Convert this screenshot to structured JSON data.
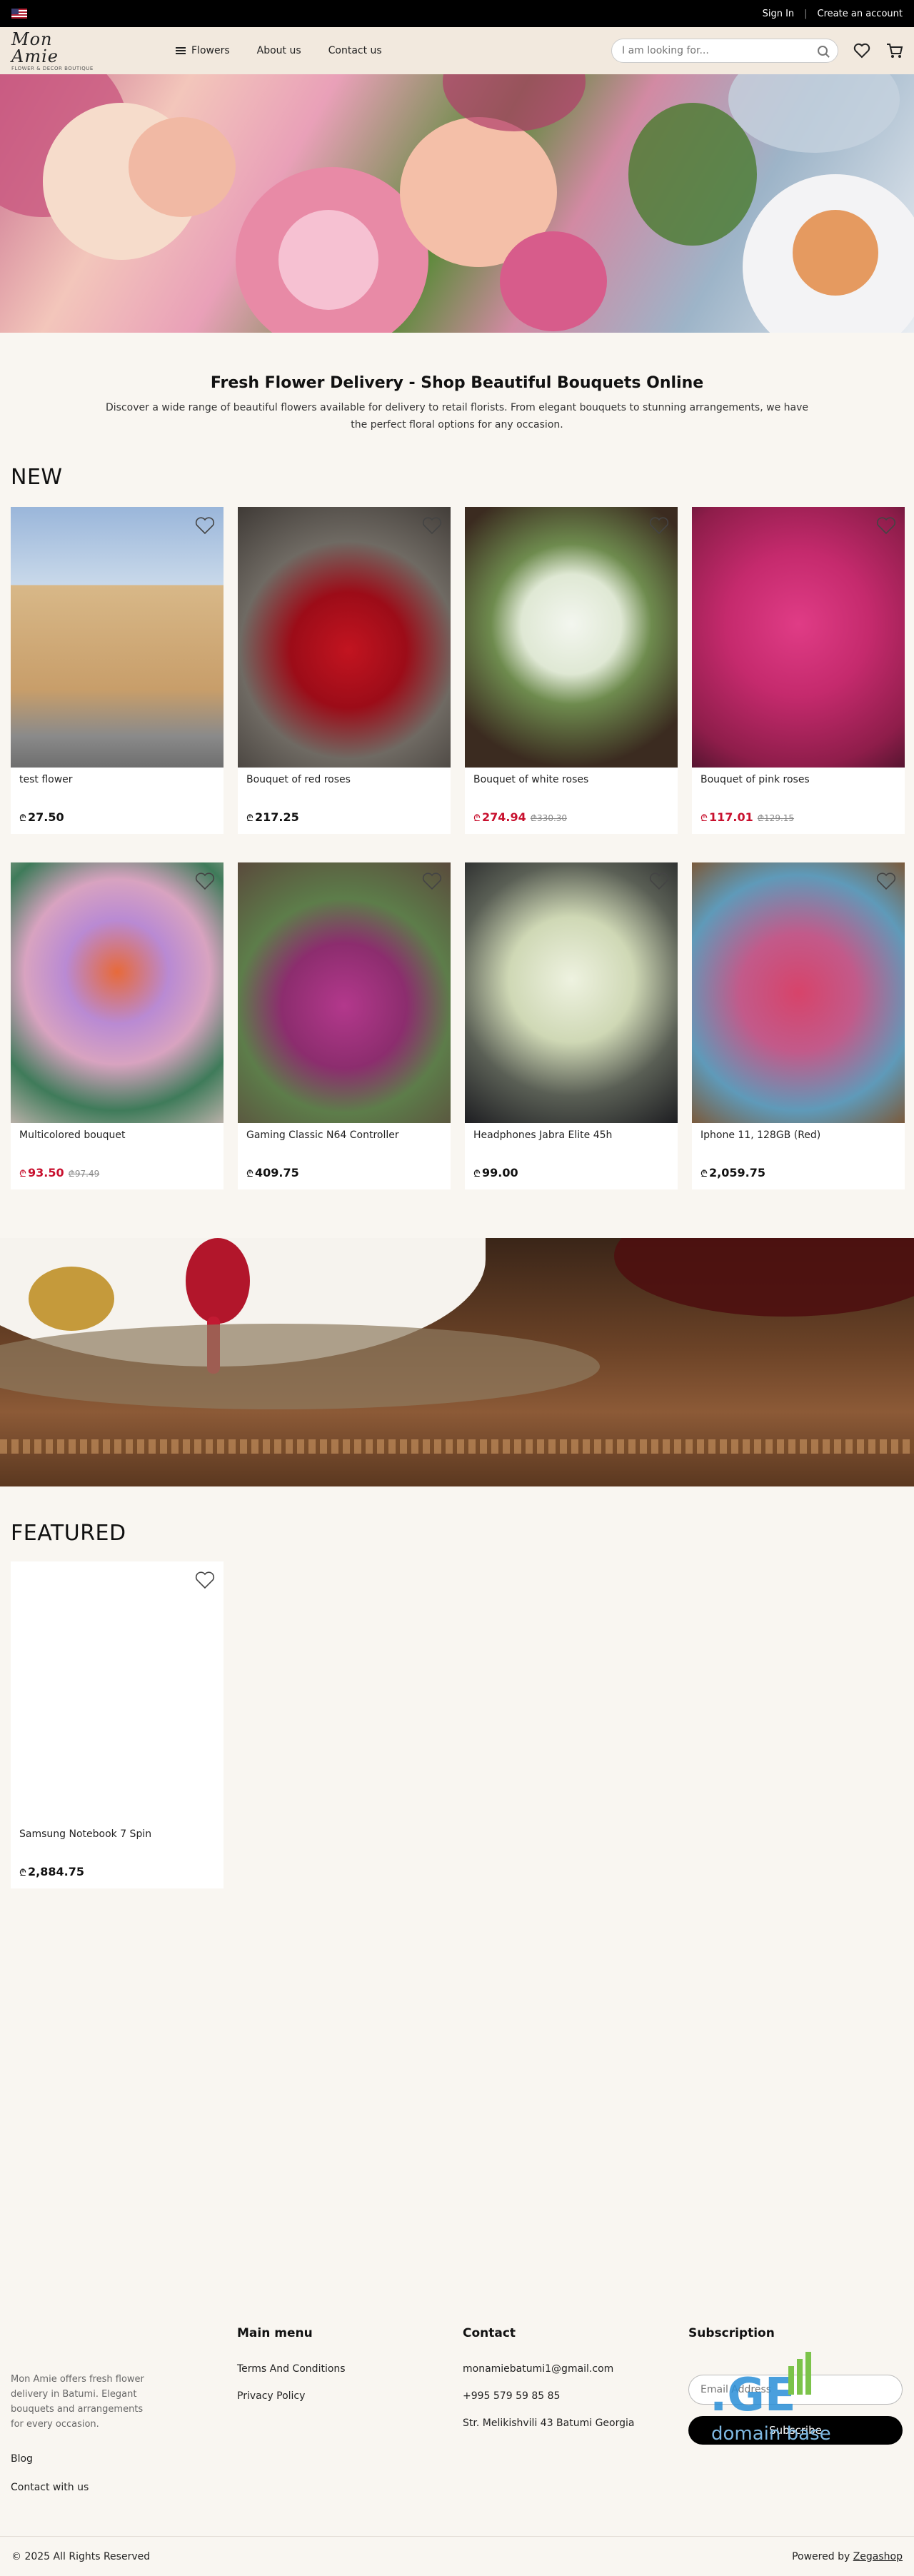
{
  "topbar": {
    "sign_in": "Sign In",
    "create_account": "Create an account",
    "flag_icon": "us-flag-icon"
  },
  "header": {
    "logo_main": "Mon Amie",
    "logo_sub": "FLOWER & DECOR BOUTIQUE",
    "nav": {
      "flowers": "Flowers",
      "about": "About us",
      "contact": "Contact us"
    },
    "search_placeholder": "I am looking for...",
    "icons": [
      "search-icon",
      "heart-icon",
      "cart-icon",
      "menu-icon"
    ]
  },
  "intro": {
    "title": "Fresh Flower Delivery - Shop Beautiful Bouquets Online",
    "text": "Discover a wide range of beautiful flowers available for delivery to retail florists. From elegant bouquets to stunning arrangements, we have the perfect floral options for any occasion."
  },
  "currency": "₾",
  "new_section": {
    "title": "NEW",
    "products": [
      {
        "name": "test flower",
        "price": "27.50",
        "old_price": "",
        "sale": false
      },
      {
        "name": "Bouquet of red roses",
        "price": "217.25",
        "old_price": "",
        "sale": false
      },
      {
        "name": "Bouquet of white roses",
        "price": "274.94",
        "old_price": "330.30",
        "sale": true
      },
      {
        "name": "Bouquet of pink roses",
        "price": "117.01",
        "old_price": "129.15",
        "sale": true
      },
      {
        "name": "Multicolored bouquet",
        "price": "93.50",
        "old_price": "97.49",
        "sale": true
      },
      {
        "name": "Gaming Classic N64 Controller",
        "price": "409.75",
        "old_price": "",
        "sale": false
      },
      {
        "name": "Headphones Jabra Elite 45h",
        "price": "99.00",
        "old_price": "",
        "sale": false
      },
      {
        "name": "Iphone 11, 128GB (Red)",
        "price": "2,059.75",
        "old_price": "",
        "sale": false
      }
    ]
  },
  "featured_section": {
    "title": "FEATURED",
    "products": [
      {
        "name": "Samsung Notebook 7 Spin",
        "price": "2,884.75"
      }
    ]
  },
  "footer": {
    "about": "Mon Amie offers fresh flower delivery in Batumi. Elegant bouquets and arrangements for every occasion.",
    "blog": "Blog",
    "contact_with_us": "Contact with us",
    "main_menu_title": "Main menu",
    "main_menu": [
      "Terms And Conditions",
      "Privacy Policy"
    ],
    "contact_title": "Contact",
    "email": "monamiebatumi1@gmail.com",
    "phone": "+995 579 59 85 85",
    "address": "Str. Melikishvili 43 Batumi Georgia",
    "subscription_title": "Subscription",
    "email_placeholder": "Email Address",
    "subscribe": "Subscribe",
    "copyright": "© 2025 All Rights Reserved",
    "powered_by": "Powered by",
    "powered_link": "Zegashop",
    "watermark_big": ".GE",
    "watermark_small": "domain base"
  }
}
